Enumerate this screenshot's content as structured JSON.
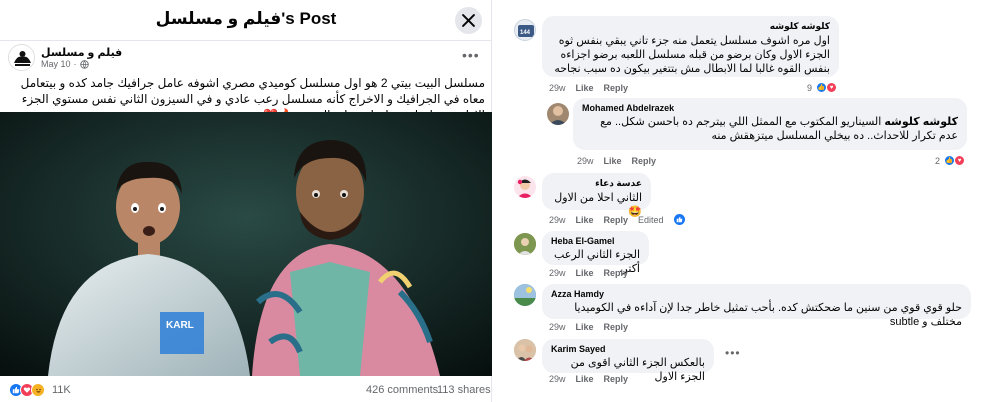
{
  "post": {
    "title": "فيلم و مسلسل's Post",
    "author": "فيلم و مسلسل",
    "date": "May 10",
    "text": "مسلسل البيت بيتي 2 هو اول مسلسل كوميدي مصري اشوفه عامل جرافيك جامد كده و بيتعامل معاه في الجرافيك و الاخراج كأنه مسلسل رعب عادي  و في السيزون الثاني نفس مستوي الجزء الاول ..مسلسل مسلسل تسلية السنين 🔥❤️",
    "reaction_count": "11K",
    "comments_count": "426 comments",
    "shares_count": "113 shares",
    "image_shirt_text": "KARL"
  },
  "comments": [
    {
      "name": "كلوشه كلوشه",
      "text": "اول مره اشوف مسلسل يتعمل منه جزء تاني يبقي بنفس ثوه الجزء الاول وكان برضو من قبله مسلسل اللعبه برضو اجزاءه بنفس القوه غالبا لما الابطال مش بتتغير بيكون ده سبب نجاحه",
      "time": "29w",
      "like": "Like",
      "reply": "Reply",
      "count": "9"
    },
    {
      "name": "Mohamed Abdelrazek",
      "mention": "كلوشه كلوشه",
      "text": "السيناريو المكتوب مع الممثل اللي بيترجم ده باحسن شكل.. مع عدم تكرار للاحداث.. ده بيخلي المسلسل ميتزهقش منه",
      "time": "29w",
      "like": "Like",
      "reply": "Reply",
      "count": "2"
    },
    {
      "name": "عدسة دعاء",
      "text": "الثاني احلا من الاول 🤩",
      "time": "29w",
      "like": "Like",
      "reply": "Reply",
      "edited": "Edited"
    },
    {
      "name": "Heba El-Gamel",
      "text": "الجزء الثاني الرعب أكتر.",
      "time": "29w",
      "like": "Like",
      "reply": "Reply"
    },
    {
      "name": "Azza Hamdy",
      "text": "حلو قوي قوي من سنين ما ضحكتش كده. بأحب تمثيل خاطر جدا لإن آداءه في الكوميديا مختلف و subtle",
      "time": "29w",
      "like": "Like",
      "reply": "Reply"
    },
    {
      "name": "Karim Sayed",
      "text": "بالعكس الجزء الثاني اقوى من الجزء الاول",
      "time": "29w",
      "like": "Like",
      "reply": "Reply"
    }
  ],
  "colors": {
    "facebook_blue": "#1877f2",
    "love_red": "#f33e58",
    "haha_yellow": "#f7b125",
    "bubble_gray": "#f0f2f5",
    "secondary_text": "#65676b"
  },
  "icons": {
    "close": "close-icon",
    "globe": "globe-icon",
    "more": "more-options-icon",
    "like": "like-reaction-icon",
    "love": "love-reaction-icon",
    "haha": "haha-reaction-icon"
  }
}
